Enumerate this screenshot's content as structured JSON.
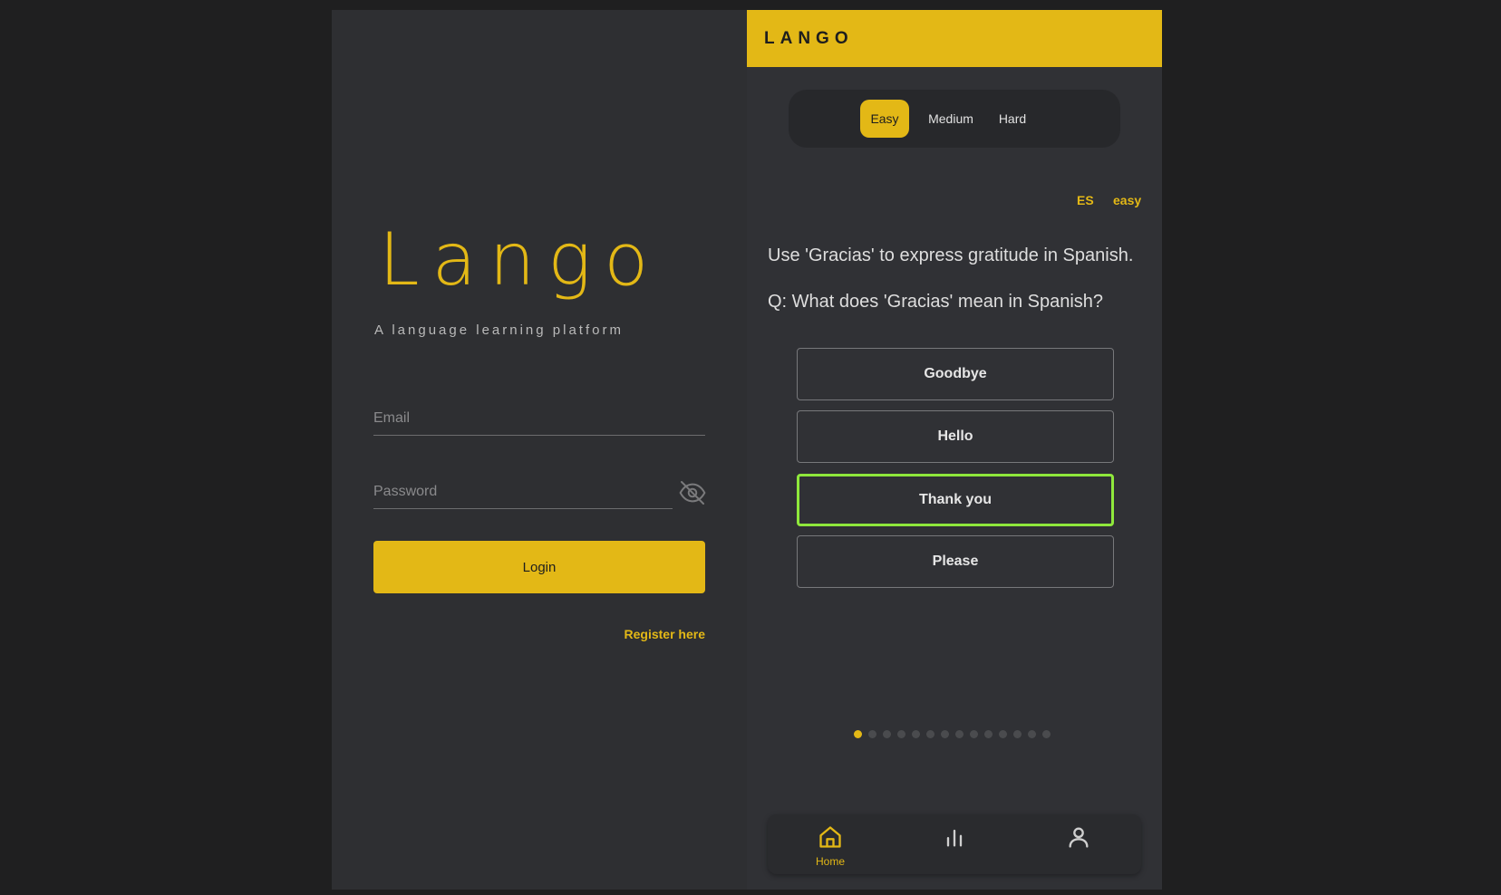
{
  "login": {
    "logo": "Lango",
    "tagline": "A language learning platform",
    "email_placeholder": "Email",
    "password_placeholder": "Password",
    "login_label": "Login",
    "register_label": "Register here",
    "password_toggle_icon": "eye-off-icon"
  },
  "quiz": {
    "brand": "LANGO",
    "difficulty_tabs": [
      {
        "label": "Easy",
        "active": true
      },
      {
        "label": "Medium",
        "active": false
      },
      {
        "label": "Hard",
        "active": false
      }
    ],
    "language_tag": "ES",
    "level_tag": "easy",
    "hint": "Use 'Gracias' to express gratitude in Spanish.",
    "question": "Q: What does 'Gracias' mean in Spanish?",
    "options": [
      {
        "label": "Goodbye",
        "state": "default"
      },
      {
        "label": "Hello",
        "state": "default"
      },
      {
        "label": "Thank you",
        "state": "correct"
      },
      {
        "label": "Please",
        "state": "default"
      }
    ],
    "progress": {
      "current": 1,
      "total": 14
    },
    "nav": [
      {
        "label": "Home",
        "icon": "home-icon",
        "active": true
      },
      {
        "label": "",
        "icon": "bar-chart-icon",
        "active": false
      },
      {
        "label": "",
        "icon": "user-icon",
        "active": false
      }
    ]
  },
  "colors": {
    "accent": "#e3b816",
    "correct": "#8fe83c",
    "panel": "#2e2f32",
    "background": "#1f1f20"
  }
}
